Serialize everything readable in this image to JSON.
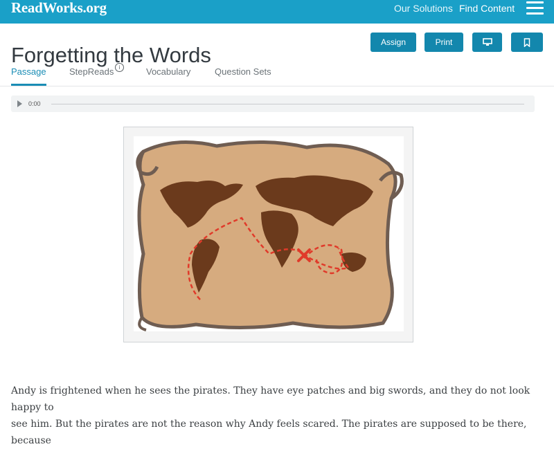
{
  "header": {
    "logo": "ReadWorks.org",
    "nav": [
      "Our Solutions",
      "Find Content"
    ]
  },
  "article": {
    "title": "Forgetting the Words"
  },
  "actions": {
    "assign": "Assign",
    "print": "Print"
  },
  "tabs": [
    "Passage",
    "StepReads",
    "Vocabulary",
    "Question Sets"
  ],
  "tab_info_glyph": "i",
  "audio": {
    "time": "0:00"
  },
  "passage": {
    "lines": [
      "Andy is frightened when he sees the pirates. They have eye patches and big swords, and they do not look happy to",
      "see him. But the pirates are not the reason why Andy feels scared. The pirates are supposed to be there, because"
    ]
  },
  "colors": {
    "brand": "#1aa0c8",
    "button": "#1387ad",
    "active_tab": "#1a8db5",
    "map_parchment": "#d6ab7f",
    "map_land": "#6b3a1c",
    "map_route": "#e03a2a"
  }
}
